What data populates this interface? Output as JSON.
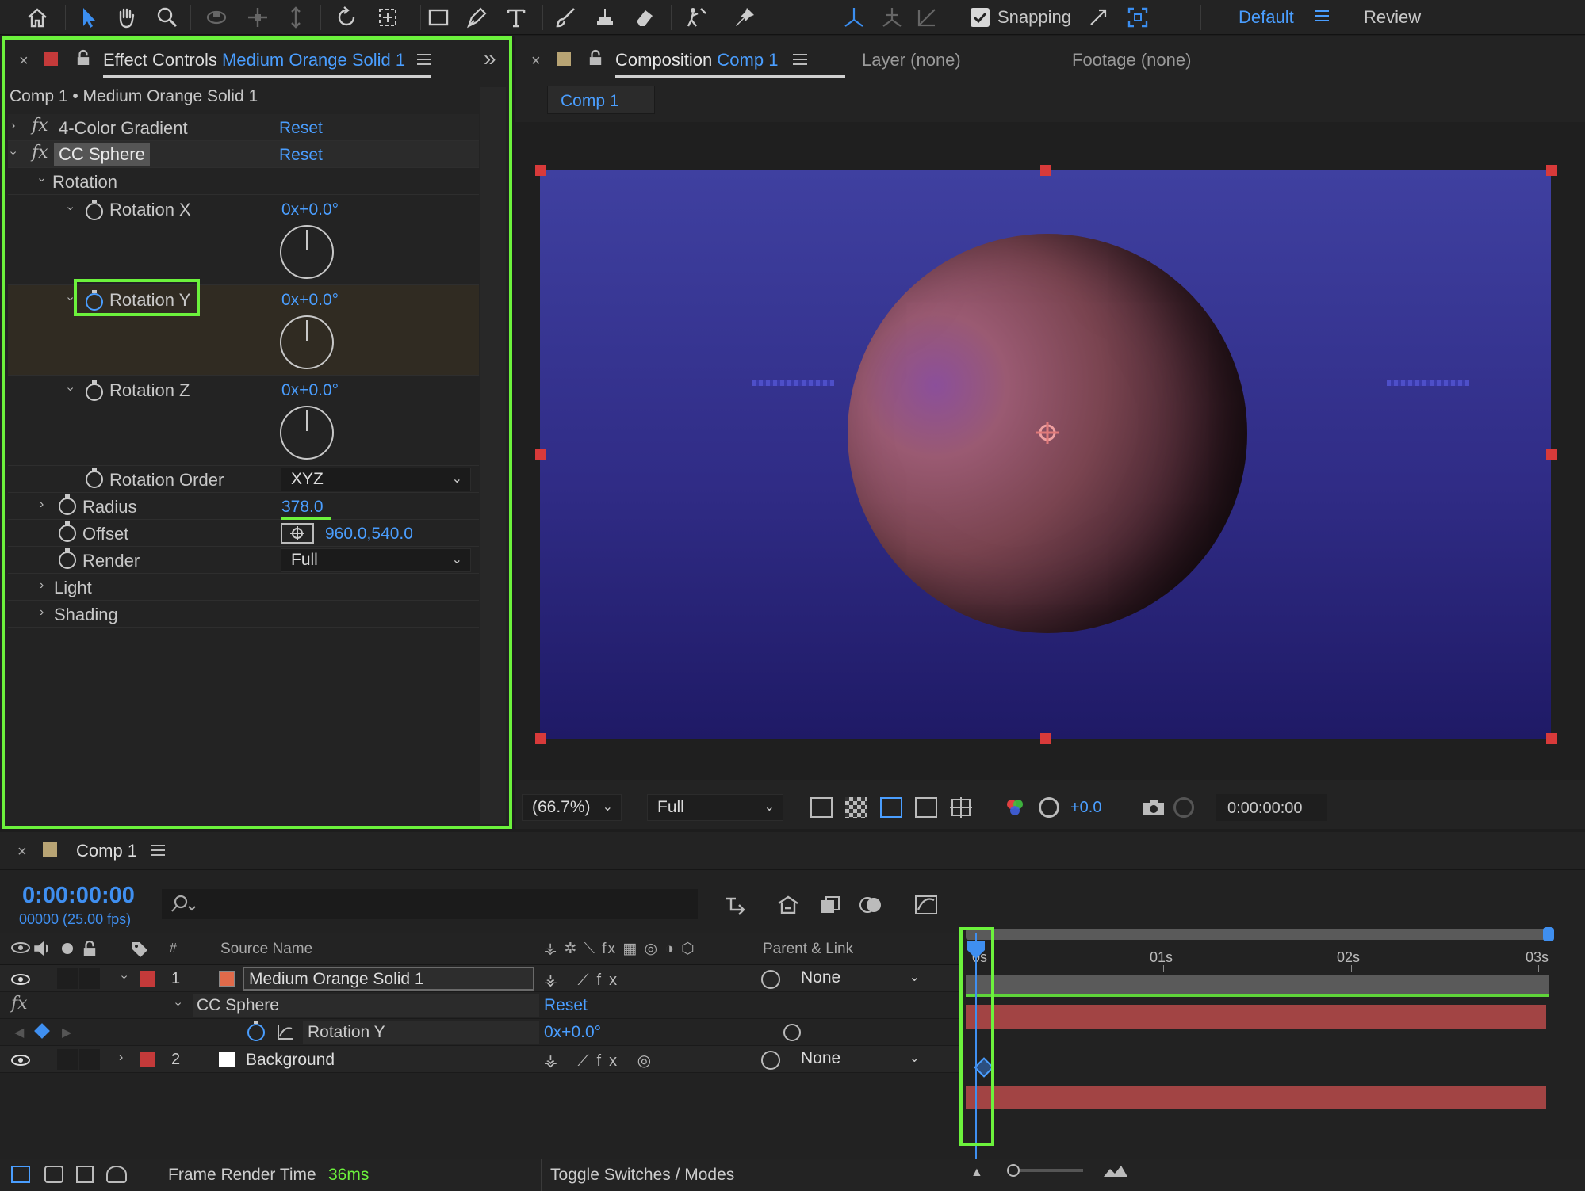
{
  "toolbar": {
    "tools": [
      "home-icon",
      "selection-tool-icon",
      "hand-tool-icon",
      "zoom-tool-icon",
      "orbit-camera-icon",
      "pan-camera-icon",
      "dolly-camera-icon",
      "rotate-tool-icon",
      "anchor-point-tool-icon",
      "rectangle-tool-icon",
      "pen-tool-icon",
      "type-tool-icon",
      "brush-tool-icon",
      "clone-stamp-tool-icon",
      "eraser-tool-icon",
      "roto-brush-tool-icon",
      "puppet-pin-tool-icon"
    ],
    "snapping_label": "Snapping",
    "workspace": "Default",
    "review_label": "Review"
  },
  "effect_controls": {
    "tab_prefix": "Effect Controls",
    "tab_layer": "Medium Orange Solid 1",
    "breadcrumb": "Comp 1 • Medium Orange Solid 1",
    "effects": [
      {
        "name": "4-Color Gradient",
        "reset": "Reset"
      },
      {
        "name": "CC Sphere",
        "reset": "Reset"
      }
    ],
    "rotation_group": "Rotation",
    "rotation_x": {
      "label": "Rotation X",
      "value": "0x+0.0°"
    },
    "rotation_y": {
      "label": "Rotation Y",
      "value": "0x+0.0°"
    },
    "rotation_z": {
      "label": "Rotation Z",
      "value": "0x+0.0°"
    },
    "rotation_order": {
      "label": "Rotation Order",
      "value": "XYZ"
    },
    "radius": {
      "label": "Radius",
      "value": "378.0"
    },
    "offset": {
      "label": "Offset",
      "value": "960.0,540.0"
    },
    "render": {
      "label": "Render",
      "value": "Full"
    },
    "light": "Light",
    "shading": "Shading"
  },
  "composition": {
    "tab_prefix": "Composition",
    "tab_comp": "Comp 1",
    "layer_tab": "Layer (none)",
    "footage_tab": "Footage (none)",
    "comp_button": "Comp 1",
    "zoom": "(66.7%)",
    "resolution": "Full",
    "exposure": "+0.0",
    "timecode": "0:00:00:00",
    "colors": {
      "bg_top": "#3f3f9a",
      "bg_bottom": "#1e1a66"
    }
  },
  "timeline": {
    "tab": "Comp 1",
    "timecode": "0:00:00:00",
    "frames": "00000 (25.00 fps)",
    "col_source_name": "Source Name",
    "col_num": "#",
    "col_parent": "Parent & Link",
    "ruler": [
      "0s",
      "01s",
      "02s",
      "03s"
    ],
    "layers": [
      {
        "index": "1",
        "name": "Medium Orange Solid 1",
        "parent": "None",
        "swatch": "#e06a4a"
      },
      {
        "index": "2",
        "name": "Background",
        "parent": "None",
        "swatch": "#ffffff"
      }
    ],
    "effect_row": {
      "name": "CC Sphere",
      "reset": "Reset"
    },
    "prop_row": {
      "name": "Rotation Y",
      "value": "0x+0.0°"
    },
    "footer": {
      "render_label": "Frame Render Time",
      "render_value": "36ms",
      "toggle": "Toggle Switches / Modes"
    }
  }
}
